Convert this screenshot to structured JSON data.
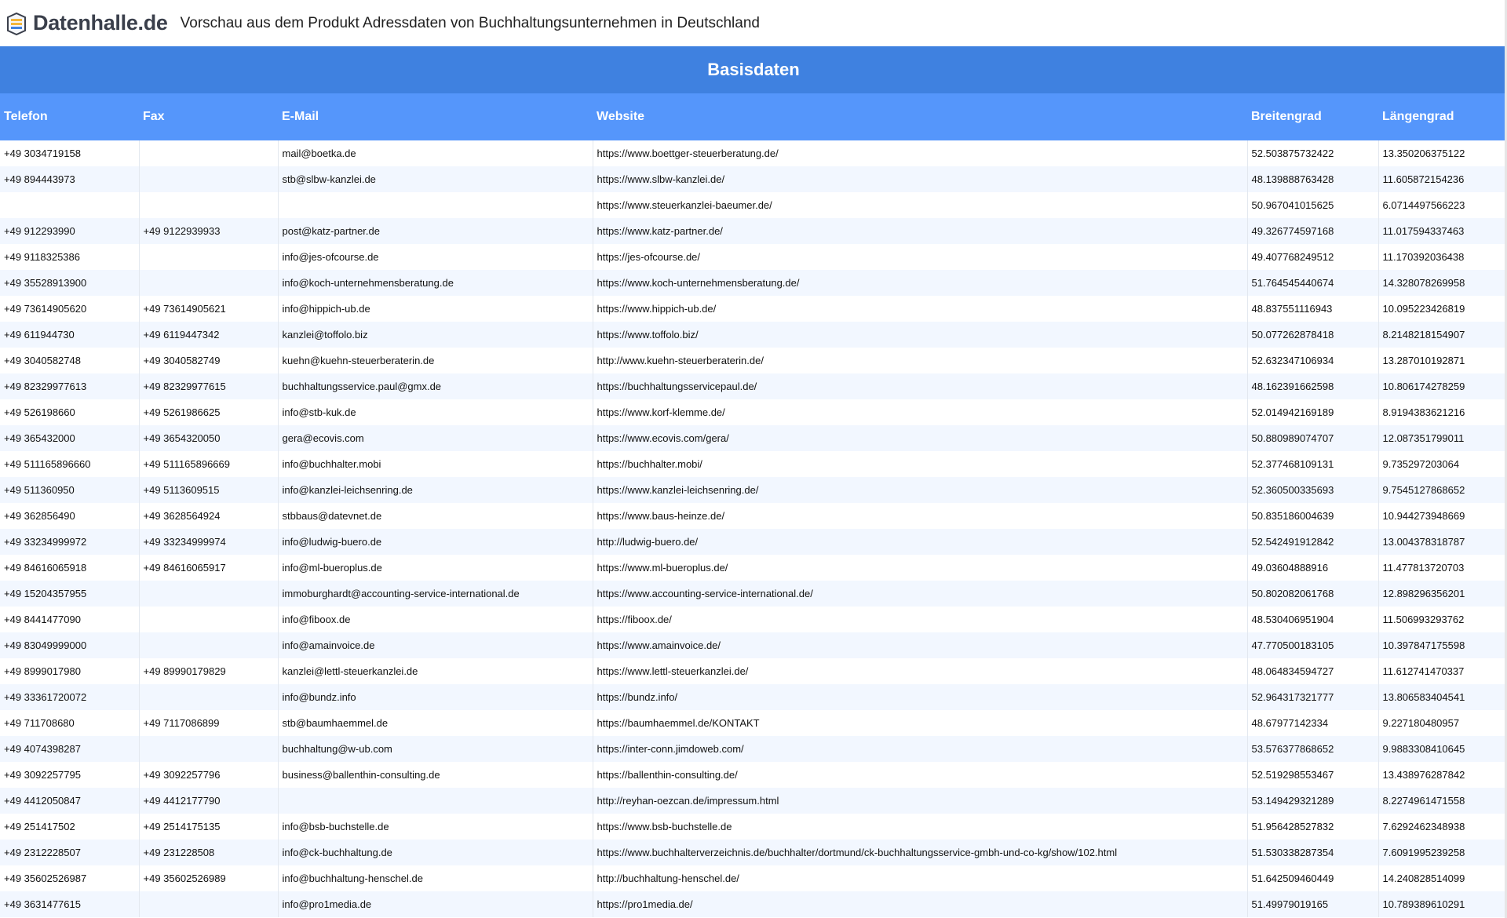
{
  "header": {
    "logo_text": "Datenhalle.de",
    "subtitle": "Vorschau aus dem Produkt Adressdaten von Buchhaltungsunternehmen in Deutschland"
  },
  "section": {
    "title": "Basisdaten"
  },
  "columns": [
    "Telefon",
    "Fax",
    "E-Mail",
    "Website",
    "Breitengrad",
    "Längengrad"
  ],
  "rows": [
    [
      "+49 3034719158",
      "",
      "mail@boetka.de",
      "https://www.boettger-steuerberatung.de/",
      "52.503875732422",
      "13.350206375122"
    ],
    [
      "+49 894443973",
      "",
      "stb@slbw-kanzlei.de",
      "https://www.slbw-kanzlei.de/",
      "48.139888763428",
      "11.605872154236"
    ],
    [
      "",
      "",
      "",
      "https://www.steuerkanzlei-baeumer.de/",
      "50.967041015625",
      "6.0714497566223"
    ],
    [
      "+49 912293990",
      "+49 9122939933",
      "post@katz-partner.de",
      "https://www.katz-partner.de/",
      "49.326774597168",
      "11.017594337463"
    ],
    [
      "+49 9118325386",
      "",
      "info@jes-ofcourse.de",
      "https://jes-ofcourse.de/",
      "49.407768249512",
      "11.170392036438"
    ],
    [
      "+49 35528913900",
      "",
      "info@koch-unternehmensberatung.de",
      "https://www.koch-unternehmensberatung.de/",
      "51.764545440674",
      "14.328078269958"
    ],
    [
      "+49 73614905620",
      "+49 73614905621",
      "info@hippich-ub.de",
      "https://www.hippich-ub.de/",
      "48.837551116943",
      "10.095223426819"
    ],
    [
      "+49 611944730",
      "+49 6119447342",
      "kanzlei@toffolo.biz",
      "https://www.toffolo.biz/",
      "50.077262878418",
      "8.2148218154907"
    ],
    [
      "+49 3040582748",
      "+49 3040582749",
      "kuehn@kuehn-steuerberaterin.de",
      "http://www.kuehn-steuerberaterin.de/",
      "52.632347106934",
      "13.287010192871"
    ],
    [
      "+49 82329977613",
      "+49 82329977615",
      "buchhaltungsservice.paul@gmx.de",
      "https://buchhaltungsservicepaul.de/",
      "48.162391662598",
      "10.806174278259"
    ],
    [
      "+49 526198660",
      "+49 5261986625",
      "info@stb-kuk.de",
      "https://www.korf-klemme.de/",
      "52.014942169189",
      "8.9194383621216"
    ],
    [
      "+49 365432000",
      "+49 3654320050",
      "gera@ecovis.com",
      "https://www.ecovis.com/gera/",
      "50.880989074707",
      "12.087351799011"
    ],
    [
      "+49 511165896660",
      "+49 511165896669",
      "info@buchhalter.mobi",
      "https://buchhalter.mobi/",
      "52.377468109131",
      "9.735297203064"
    ],
    [
      "+49 511360950",
      "+49 5113609515",
      "info@kanzlei-leichsenring.de",
      "https://www.kanzlei-leichsenring.de/",
      "52.360500335693",
      "9.7545127868652"
    ],
    [
      "+49 362856490",
      "+49 3628564924",
      "stbbaus@datevnet.de",
      "https://www.baus-heinze.de/",
      "50.835186004639",
      "10.944273948669"
    ],
    [
      "+49 33234999972",
      "+49 33234999974",
      "info@ludwig-buero.de",
      "http://ludwig-buero.de/",
      "52.542491912842",
      "13.004378318787"
    ],
    [
      "+49 84616065918",
      "+49 84616065917",
      "info@ml-bueroplus.de",
      "https://www.ml-bueroplus.de/",
      "49.03604888916",
      "11.477813720703"
    ],
    [
      "+49 15204357955",
      "",
      "immoburghardt@accounting-service-international.de",
      "https://www.accounting-service-international.de/",
      "50.802082061768",
      "12.898296356201"
    ],
    [
      "+49 8441477090",
      "",
      "info@fiboox.de",
      "https://fiboox.de/",
      "48.530406951904",
      "11.506993293762"
    ],
    [
      "+49 83049999000",
      "",
      "info@amainvoice.de",
      "https://www.amainvoice.de/",
      "47.770500183105",
      "10.397847175598"
    ],
    [
      "+49 8999017980",
      "+49 89990179829",
      "kanzlei@lettl-steuerkanzlei.de",
      "https://www.lettl-steuerkanzlei.de/",
      "48.064834594727",
      "11.612741470337"
    ],
    [
      "+49 33361720072",
      "",
      "info@bundz.info",
      "https://bundz.info/",
      "52.964317321777",
      "13.806583404541"
    ],
    [
      "+49 711708680",
      "+49 7117086899",
      "stb@baumhaemmel.de",
      "https://baumhaemmel.de/KONTAKT",
      "48.67977142334",
      "9.227180480957"
    ],
    [
      "+49 4074398287",
      "",
      "buchhaltung@w-ub.com",
      "https://inter-conn.jimdoweb.com/",
      "53.576377868652",
      "9.9883308410645"
    ],
    [
      "+49 3092257795",
      "+49 3092257796",
      "business@ballenthin-consulting.de",
      "https://ballenthin-consulting.de/",
      "52.519298553467",
      "13.438976287842"
    ],
    [
      "+49 4412050847",
      "+49 4412177790",
      "",
      "http://reyhan-oezcan.de/impressum.html",
      "53.149429321289",
      "8.2274961471558"
    ],
    [
      "+49 251417502",
      "+49 2514175135",
      "info@bsb-buchstelle.de",
      "https://www.bsb-buchstelle.de",
      "51.956428527832",
      "7.6292462348938"
    ],
    [
      "+49 2312228507",
      "+49 231228508",
      "info@ck-buchhaltung.de",
      "https://www.buchhalterverzeichnis.de/buchhalter/dortmund/ck-buchhaltungsservice-gmbh-und-co-kg/show/102.html",
      "51.530338287354",
      "7.6091995239258"
    ],
    [
      "+49 35602526987",
      "+49 35602526989",
      "info@buchhaltung-henschel.de",
      "http://buchhaltung-henschel.de/",
      "51.642509460449",
      "14.240828514099"
    ],
    [
      "+49 3631477615",
      "",
      "info@pro1media.de",
      "https://pro1media.de/",
      "51.49979019165",
      "10.789389610291"
    ]
  ]
}
